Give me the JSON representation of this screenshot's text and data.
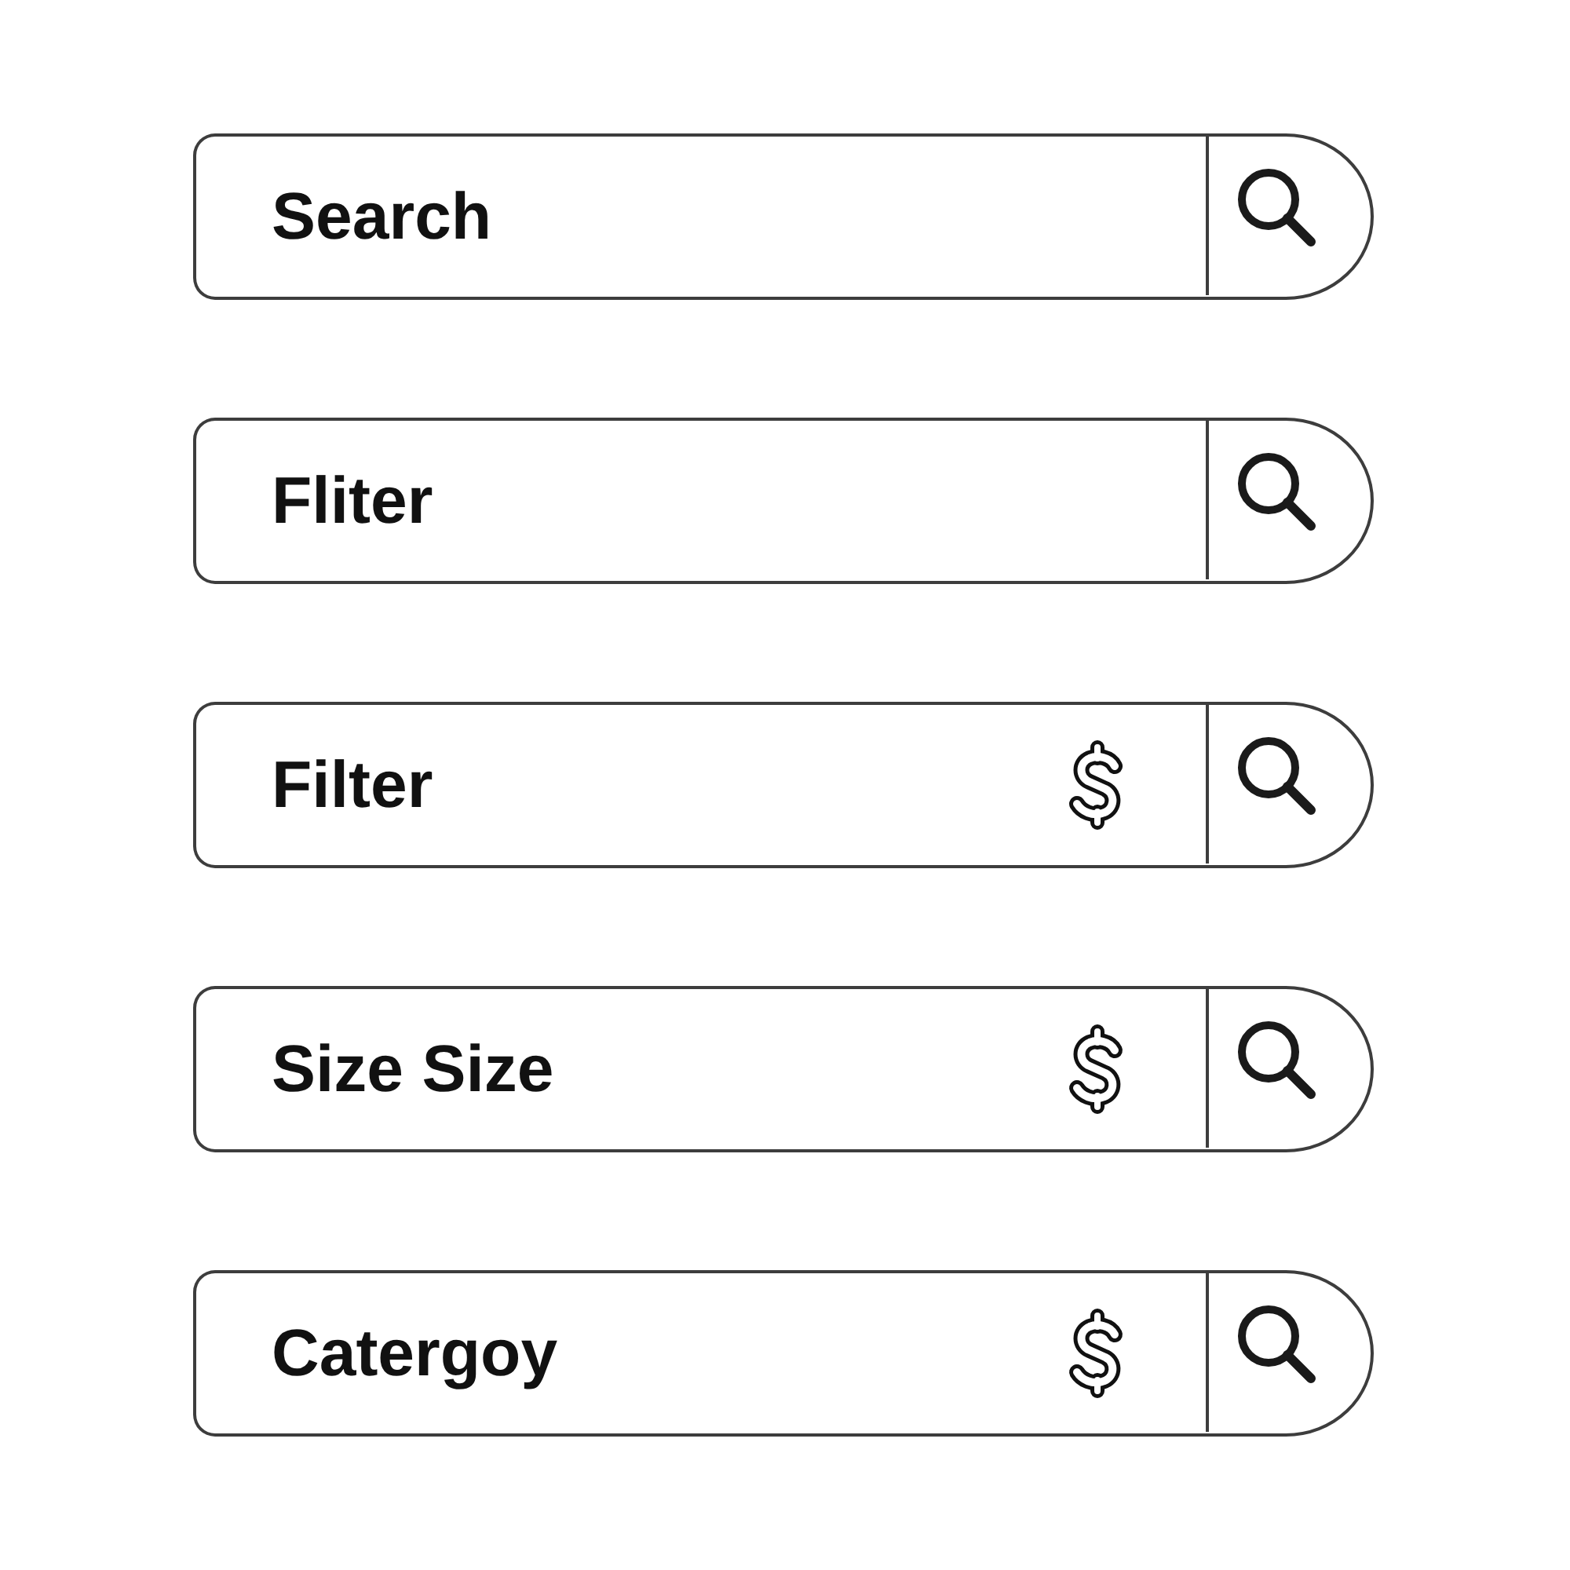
{
  "search_bars": [
    {
      "kind": "plain",
      "placeholder": "Search"
    },
    {
      "kind": "plain",
      "placeholder": "Fliter"
    },
    {
      "kind": "price",
      "placeholder": "Filter"
    },
    {
      "kind": "price",
      "placeholder": "Size Size"
    },
    {
      "kind": "price",
      "placeholder": "Catergoy"
    }
  ]
}
